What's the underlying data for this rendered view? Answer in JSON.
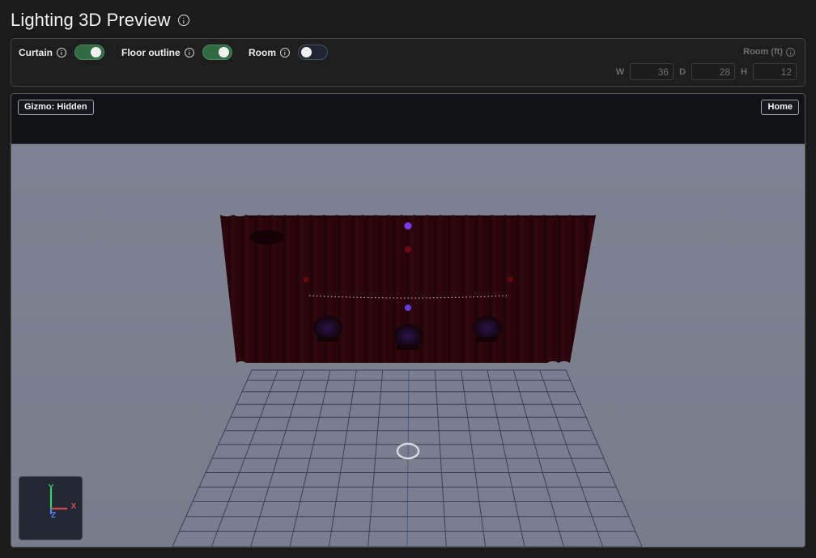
{
  "header": {
    "title": "Lighting 3D Preview",
    "info_icon": "info-icon"
  },
  "controls": {
    "toggles": [
      {
        "label": "Curtain",
        "on": true
      },
      {
        "label": "Floor outline",
        "on": true
      },
      {
        "label": "Room",
        "on": false
      }
    ],
    "room": {
      "title": "Room (ft)",
      "width_label": "W",
      "width_value": "36",
      "depth_label": "D",
      "depth_value": "28",
      "height_label": "H",
      "height_value": "12"
    }
  },
  "viewport": {
    "gizmo_label": "Gizmo: Hidden",
    "home_label": "Home",
    "axes": {
      "y": "Y",
      "x": "X",
      "z": "Z"
    }
  },
  "colors": {
    "toggle_on": "#2f6a43",
    "toggle_off": "#1f2433",
    "curtain": "#2a0509",
    "viewport_background": "#7c8090",
    "light_purple": "#7b3cf0",
    "light_red": "#6a0a12"
  }
}
